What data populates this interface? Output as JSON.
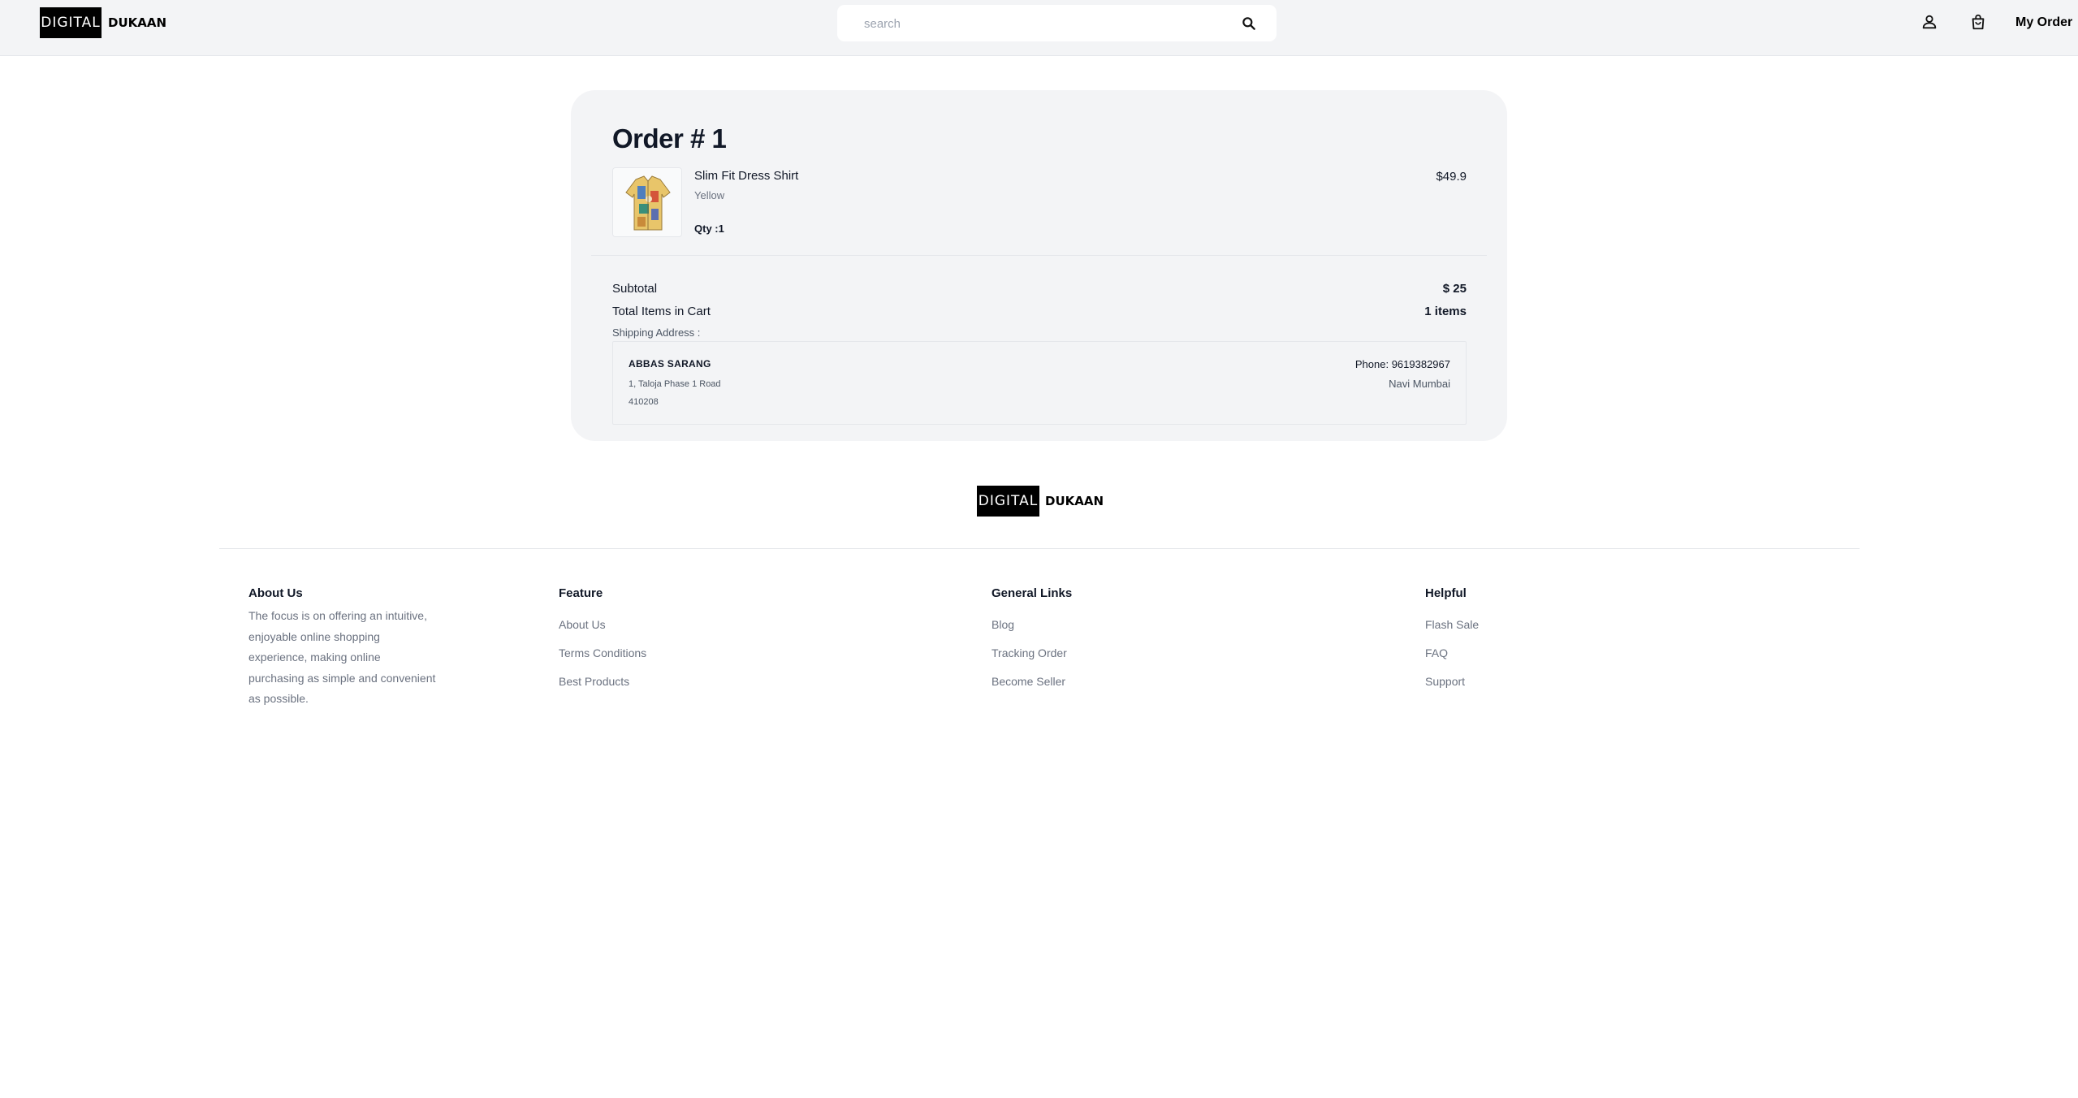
{
  "header": {
    "logo": {
      "box_text": "DIGITAL",
      "word": "DUKAAN"
    },
    "search": {
      "placeholder": "search",
      "value": ""
    },
    "icons": [
      "user-icon",
      "bag-icon",
      "search-icon"
    ],
    "my_order_label": "My Order"
  },
  "order": {
    "title": "Order # 1",
    "item": {
      "name": "Slim Fit Dress Shirt",
      "color": "Yellow",
      "qty": "Qty :1",
      "price": "$49.9"
    },
    "summary": {
      "subtotal_label": "Subtotal",
      "subtotal_value": "$ 25",
      "items_label": "Total Items in Cart",
      "items_value": "1 items"
    },
    "shipping": {
      "label": "Shipping Address :",
      "name": "ABBAS SARANG",
      "line1": "1, Taloja Phase 1 Road",
      "line2": "410208",
      "phone": "Phone: 9619382967",
      "city": "Navi Mumbai"
    }
  },
  "footer": {
    "logo": {
      "box_text": "DIGITAL",
      "word": "DUKAAN"
    },
    "about": {
      "heading": "About Us",
      "text": "The focus is on offering an intuitive, enjoyable online shopping experience, making online purchasing as simple and convenient as possible."
    },
    "columns": [
      {
        "heading": "Feature",
        "links": [
          "About Us",
          "Terms Conditions",
          "Best Products"
        ]
      },
      {
        "heading": "General Links",
        "links": [
          "Blog",
          "Tracking Order",
          "Become Seller"
        ]
      },
      {
        "heading": "Helpful",
        "links": [
          "Flash Sale",
          "FAQ",
          "Support"
        ]
      }
    ]
  },
  "colors": {
    "header_bg": "#f3f4f6",
    "card_bg": "#f3f4f6",
    "text": "#111827",
    "muted": "#6b7280",
    "logo_box": "#000000"
  }
}
